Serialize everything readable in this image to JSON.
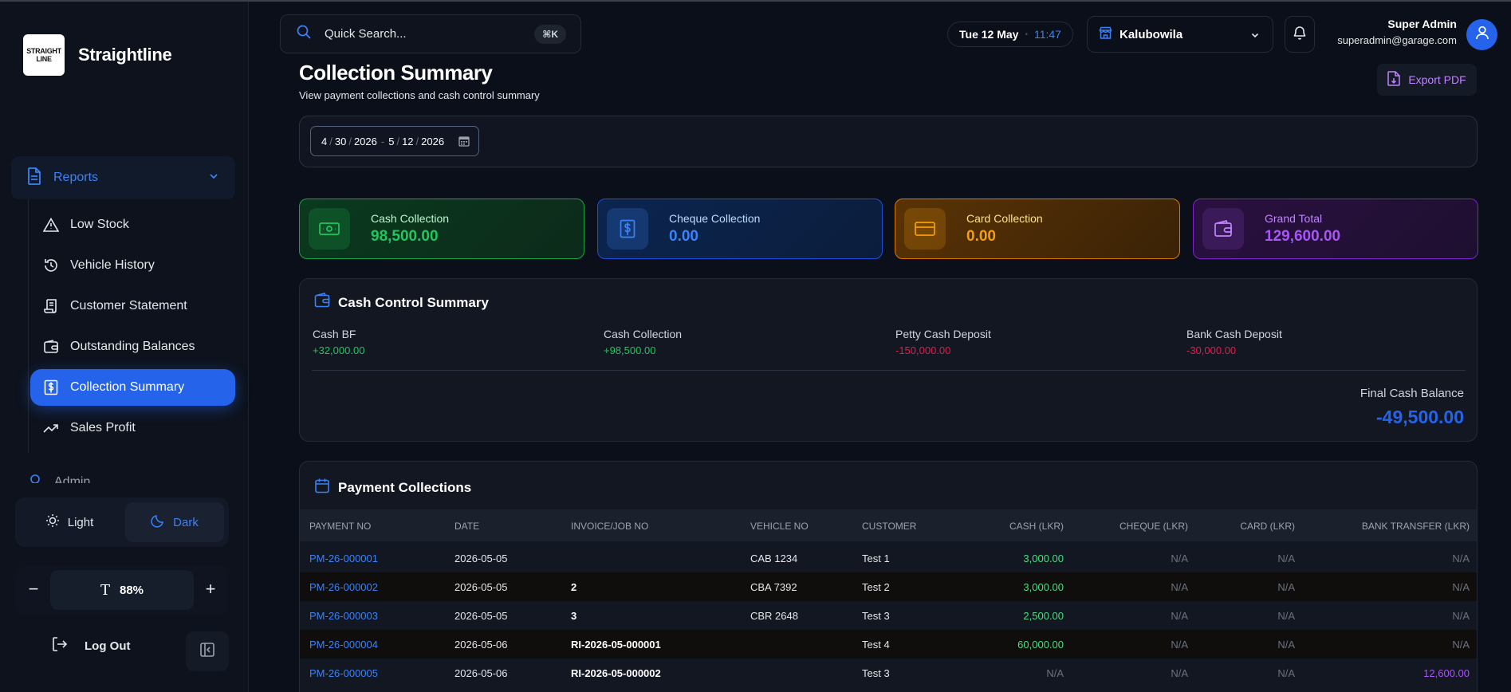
{
  "brand": {
    "logo_line1": "STRAIGHT",
    "logo_line2": "LINE",
    "name": "Straightline"
  },
  "sidebar": {
    "group_label": "Reports",
    "items": [
      {
        "label": "Low Stock",
        "icon": "warning-icon"
      },
      {
        "label": "Vehicle History",
        "icon": "history-icon"
      },
      {
        "label": "Customer Statement",
        "icon": "scroll-icon"
      },
      {
        "label": "Outstanding Balances",
        "icon": "wallet-icon"
      },
      {
        "label": "Collection Summary",
        "icon": "receipt-dollar-icon"
      },
      {
        "label": "Sales Profit",
        "icon": "trend-up-icon"
      }
    ],
    "next_group_label": "Admin",
    "theme_light": "Light",
    "theme_dark": "Dark",
    "zoom_glyph": "T",
    "zoom_value": "88%",
    "zoom_minus": "−",
    "zoom_plus": "+",
    "logout": "Log Out"
  },
  "header": {
    "search_placeholder": "Quick Search...",
    "search_shortcut": "⌘K",
    "date": "Tue 12 May",
    "time_sep": "•",
    "time": "11:47",
    "branch": "Kalubowila",
    "user_name": "Super Admin",
    "user_email": "superadmin@garage.com"
  },
  "page": {
    "title": "Collection Summary",
    "subtitle": "View payment collections and cash control summary",
    "export_label": "Export PDF",
    "date_from": {
      "m": "4",
      "d": "30",
      "y": "2026"
    },
    "date_to": {
      "m": "5",
      "d": "12",
      "y": "2026"
    },
    "date_slash": "/",
    "date_dash": "-"
  },
  "stats": [
    {
      "label": "Cash Collection",
      "value": "98,500.00"
    },
    {
      "label": "Cheque Collection",
      "value": "0.00"
    },
    {
      "label": "Card Collection",
      "value": "0.00"
    },
    {
      "label": "Grand Total",
      "value": "129,600.00"
    }
  ],
  "cash_control": {
    "title": "Cash Control Summary",
    "items": [
      {
        "label": "Cash BF",
        "value": "+32,000.00"
      },
      {
        "label": "Cash Collection",
        "value": "+98,500.00"
      },
      {
        "label": "Petty Cash Deposit",
        "value": "-150,000.00"
      },
      {
        "label": "Bank Cash Deposit",
        "value": "-30,000.00"
      }
    ],
    "final_label": "Final Cash Balance",
    "final_value": "-49,500.00"
  },
  "payments": {
    "title": "Payment Collections",
    "columns": [
      "PAYMENT NO",
      "DATE",
      "INVOICE/JOB NO",
      "VEHICLE NO",
      "CUSTOMER",
      "CASH (LKR)",
      "CHEQUE (LKR)",
      "CARD (LKR)",
      "BANK TRANSFER (LKR)"
    ],
    "rows": [
      {
        "payment_no": "PM-26-000001",
        "date": "2026-05-05",
        "invoice": "",
        "vehicle": "CAB 1234",
        "customer": "Test 1",
        "cash": "3,000.00",
        "cheque": "N/A",
        "card": "N/A",
        "bank": "N/A"
      },
      {
        "payment_no": "PM-26-000002",
        "date": "2026-05-05",
        "invoice": "2",
        "vehicle": "CBA 7392",
        "customer": "Test 2",
        "cash": "3,000.00",
        "cheque": "N/A",
        "card": "N/A",
        "bank": "N/A"
      },
      {
        "payment_no": "PM-26-000003",
        "date": "2026-05-05",
        "invoice": "3",
        "vehicle": "CBR 2648",
        "customer": "Test 3",
        "cash": "2,500.00",
        "cheque": "N/A",
        "card": "N/A",
        "bank": "N/A"
      },
      {
        "payment_no": "PM-26-000004",
        "date": "2026-05-06",
        "invoice": "RI-2026-05-000001",
        "vehicle": "",
        "customer": "Test 4",
        "cash": "60,000.00",
        "cheque": "N/A",
        "card": "N/A",
        "bank": "N/A"
      },
      {
        "payment_no": "PM-26-000005",
        "date": "2026-05-06",
        "invoice": "RI-2026-05-000002",
        "vehicle": "",
        "customer": "Test 3",
        "cash": "N/A",
        "cheque": "N/A",
        "card": "N/A",
        "bank": "12,600.00"
      }
    ]
  },
  "colors": {
    "accent": "#2563eb",
    "cash": "#22c55e",
    "cheque": "#3b82f6",
    "card": "#f59e0b",
    "total": "#a855f7",
    "negative": "#e11d48"
  }
}
